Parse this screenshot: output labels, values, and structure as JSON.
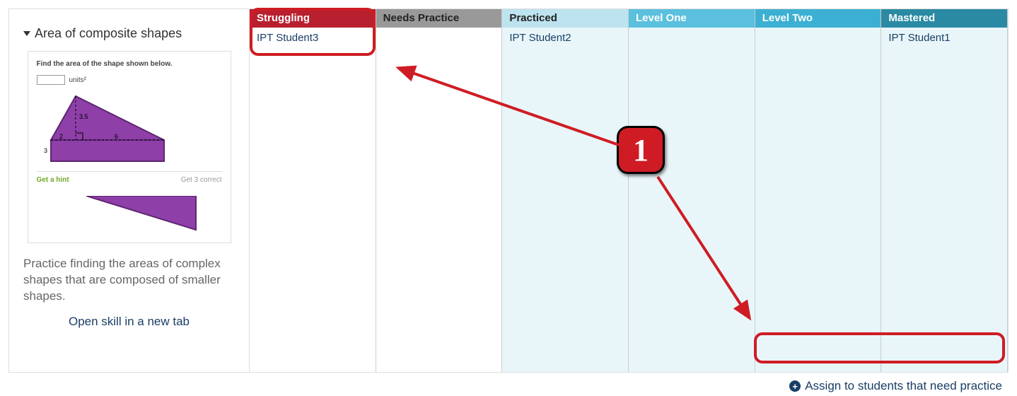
{
  "sidebar": {
    "title": "Area of composite shapes",
    "preview": {
      "question": "Find the area of the shape shown below.",
      "units_label": "units²",
      "dim_a": "3.5",
      "dim_b": "2",
      "dim_c": "6",
      "dim_d": "3",
      "hint_label": "Get a hint",
      "correct_label": "Get 3 correct"
    },
    "description": "Practice finding the areas of complex shapes that are composed of smaller shapes.",
    "open_link": "Open skill in a new tab"
  },
  "columns": {
    "struggling": {
      "label": "Struggling",
      "students": [
        "IPT Student3"
      ]
    },
    "needs": {
      "label": "Needs Practice",
      "students": []
    },
    "practiced": {
      "label": "Practiced",
      "students": [
        "IPT Student2"
      ]
    },
    "level1": {
      "label": "Level One",
      "students": []
    },
    "level2": {
      "label": "Level Two",
      "students": []
    },
    "mastered": {
      "label": "Mastered",
      "students": [
        "IPT Student1"
      ]
    }
  },
  "assign_label": "Assign to students that need practice",
  "annotation": {
    "badge": "1"
  }
}
